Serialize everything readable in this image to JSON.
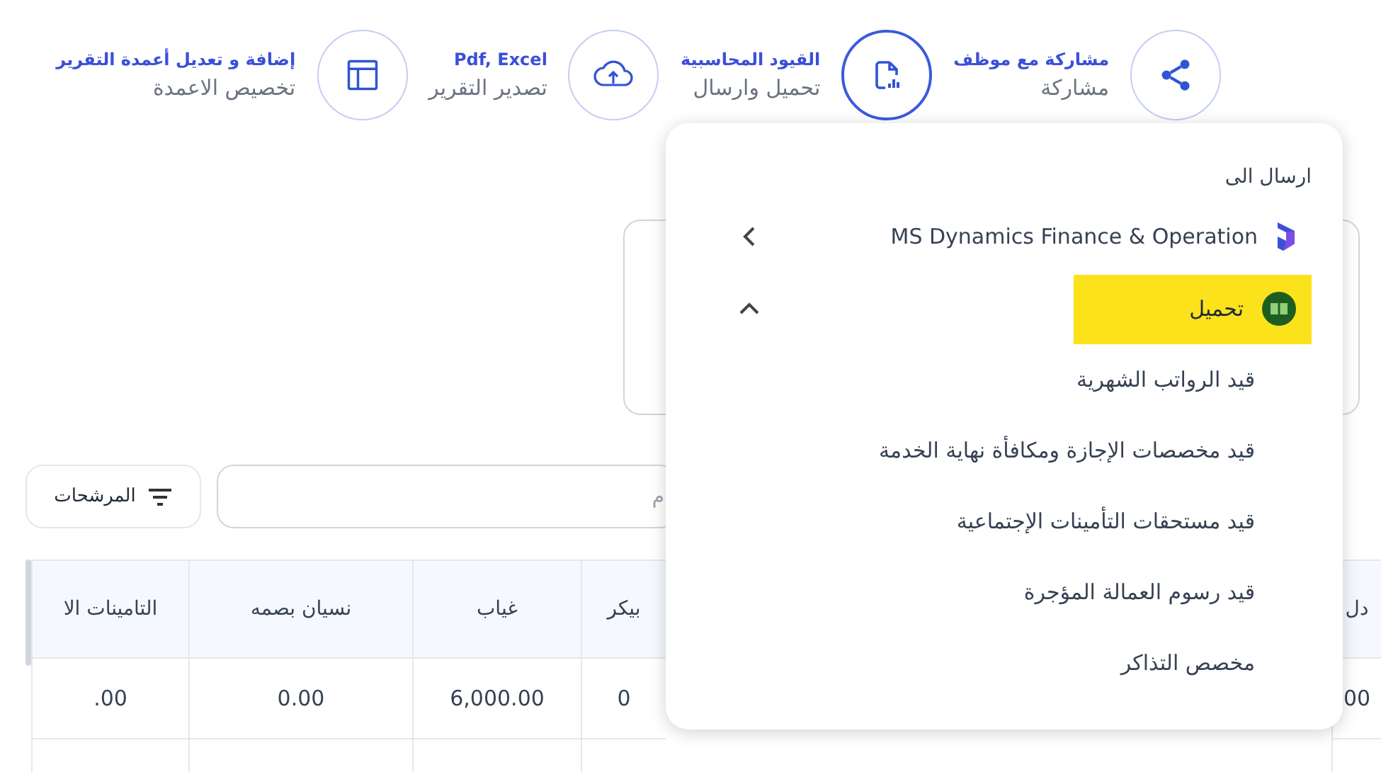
{
  "toolbar": [
    {
      "kind": "share",
      "title": "مشاركة مع موظف",
      "subtitle": "مشاركة",
      "selected": false
    },
    {
      "kind": "report",
      "title": "القيود المحاسبية",
      "subtitle": "تحميل وارسال",
      "selected": true
    },
    {
      "kind": "upload",
      "title": "Pdf, Excel",
      "subtitle": "تصدير التقرير",
      "selected": false
    },
    {
      "kind": "columns",
      "title": "إضافة و تعديل أعمدة التقرير",
      "subtitle": "تخصيص الاعمدة",
      "selected": false
    }
  ],
  "search": {
    "placeholder": "م"
  },
  "filters_button": {
    "label": "المرشحات"
  },
  "table": {
    "columns": [
      {
        "header": "دل",
        "cells": [
          "00"
        ]
      },
      {
        "header": "بيكر",
        "cells": [
          "0"
        ]
      },
      {
        "header": "غياب",
        "cells": [
          "6,000.00"
        ]
      },
      {
        "header": "نسيان بصمه",
        "cells": [
          "0.00"
        ]
      },
      {
        "header": "التامينات الا",
        "cells": [
          ".00"
        ]
      }
    ]
  },
  "menu": {
    "title": "ارسال الى",
    "items": [
      {
        "kind": "integration",
        "label": "MS Dynamics Finance & Operation",
        "expanded": false,
        "highlighted": false
      },
      {
        "kind": "download",
        "label": "تحميل",
        "expanded": true,
        "highlighted": true,
        "children": [
          {
            "label": "قيد الرواتب الشهرية"
          },
          {
            "label": "قيد مخصصات الإجازة ومكافأة نهاية الخدمة"
          },
          {
            "label": "قيد مستحقات التأمينات الإجتماعية"
          },
          {
            "label": "قيد رسوم العمالة المؤجرة"
          },
          {
            "label": "مخصص التذاكر"
          }
        ]
      }
    ]
  }
}
